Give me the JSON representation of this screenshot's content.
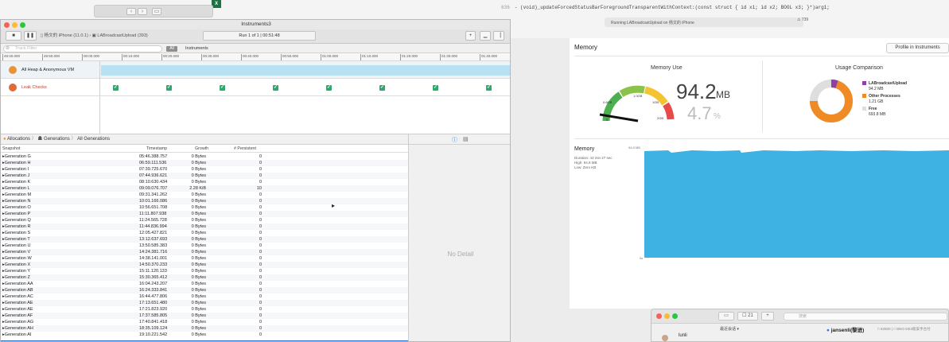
{
  "background": {
    "code_line_number": "636",
    "code_text": "- (void)_updateForcedStatusBarForegroundTransparentWithContext:(const struct { id x1; id x2; BOOL x3; }*)arg1;",
    "status_text": "Running LABroadcastUpload on 杨文的 iPhone",
    "status_count": "739",
    "excel_badge": "X"
  },
  "memory_panel": {
    "title": "Memory",
    "profile_button": "Profile in Instruments",
    "memory_use_title": "Memory Use",
    "value": "94.2",
    "unit": "MB",
    "percent": "4.7",
    "percent_sign": "%",
    "gauge_labels": [
      "0.6GB",
      "1.0GB",
      "1GB",
      "2GB",
      "0"
    ],
    "usage_title": "Usage Comparison",
    "legend": [
      {
        "name": "LABroadcastUpload",
        "value": "94.2 MB",
        "color": "#8e3fa8"
      },
      {
        "name": "Other Processes",
        "value": "1.21 GB",
        "color": "#f08a24"
      },
      {
        "name": "Free",
        "value": "693.8 MB",
        "color": "#dedede"
      }
    ],
    "graph_title": "Memory",
    "graph_info": [
      "Duration: 43 min 27 sec",
      "High: 94.8 MB",
      "Low: Zero KB"
    ],
    "graph_y_label": "94.8 MB",
    "graph_x_label": "0s",
    "graph_color": "#3db2e3"
  },
  "instruments": {
    "window_title": "Instruments3",
    "device": "杨文的 iPhone (11.0.1)",
    "target": "LABroadcastUpload (393)",
    "run_info": "Run 1 of 1  |  00:51:48",
    "filter_placeholder": "Track Filter",
    "filter_all": "All",
    "filter_instruments": "Instruments",
    "ruler_ticks": [
      "49:40.000",
      "49:50.000",
      "00:00.000",
      "00:10.000",
      "00:20.000",
      "00:30.000",
      "00:40.000",
      "00:50.000",
      "01:00.000",
      "01:10.000",
      "01:20.000",
      "01:30.000",
      "01:40.000"
    ],
    "tracks": [
      {
        "label": "All Heap & Anonymous VM",
        "color": "#e8943a"
      },
      {
        "label": "Leak Checks",
        "color": "#e06a3a"
      }
    ],
    "check_count": 8,
    "nav": {
      "allocations": "Allocations",
      "generations": "Generations",
      "all_generations": "All Generations"
    },
    "columns": {
      "snapshot": "Snapshot",
      "timestamp": "Timestamp",
      "growth": "Growth",
      "persistent": "# Persistent"
    },
    "rows": [
      {
        "name": "Generation G",
        "time": "05:46.388.757",
        "growth": "0 Bytes",
        "persistent": "0"
      },
      {
        "name": "Generation H",
        "time": "06:59.111.536",
        "growth": "0 Bytes",
        "persistent": "0"
      },
      {
        "name": "Generation I",
        "time": "07:39.725.670",
        "growth": "0 Bytes",
        "persistent": "0"
      },
      {
        "name": "Generation J",
        "time": "07:44.936.621",
        "growth": "0 Bytes",
        "persistent": "0"
      },
      {
        "name": "Generation K",
        "time": "08:10.630.434",
        "growth": "0 Bytes",
        "persistent": "0"
      },
      {
        "name": "Generation L",
        "time": "09:09.076.707",
        "growth": "2.28 KiB",
        "persistent": "10"
      },
      {
        "name": "Generation M",
        "time": "09:31.341.262",
        "growth": "0 Bytes",
        "persistent": "0"
      },
      {
        "name": "Generation N",
        "time": "10:01.166.086",
        "growth": "0 Bytes",
        "persistent": "0"
      },
      {
        "name": "Generation O",
        "time": "10:56.651.708",
        "growth": "0 Bytes",
        "persistent": "0"
      },
      {
        "name": "Generation P",
        "time": "11:11.807.938",
        "growth": "0 Bytes",
        "persistent": "0"
      },
      {
        "name": "Generation Q",
        "time": "11:24.565.728",
        "growth": "0 Bytes",
        "persistent": "0"
      },
      {
        "name": "Generation R",
        "time": "11:44.836.994",
        "growth": "0 Bytes",
        "persistent": "0"
      },
      {
        "name": "Generation S",
        "time": "12:05.427.821",
        "growth": "0 Bytes",
        "persistent": "0"
      },
      {
        "name": "Generation T",
        "time": "13:12.637.693",
        "growth": "0 Bytes",
        "persistent": "0"
      },
      {
        "name": "Generation U",
        "time": "13:50.585.383",
        "growth": "0 Bytes",
        "persistent": "0"
      },
      {
        "name": "Generation V",
        "time": "14:24.381.716",
        "growth": "0 Bytes",
        "persistent": "0"
      },
      {
        "name": "Generation W",
        "time": "14:38.141.001",
        "growth": "0 Bytes",
        "persistent": "0"
      },
      {
        "name": "Generation X",
        "time": "14:50.370.233",
        "growth": "0 Bytes",
        "persistent": "0"
      },
      {
        "name": "Generation Y",
        "time": "15:11.120.133",
        "growth": "0 Bytes",
        "persistent": "0"
      },
      {
        "name": "Generation Z",
        "time": "15:30.365.412",
        "growth": "0 Bytes",
        "persistent": "0"
      },
      {
        "name": "Generation AA",
        "time": "16:04.243.207",
        "growth": "0 Bytes",
        "persistent": "0"
      },
      {
        "name": "Generation AB",
        "time": "16:24.333.841",
        "growth": "0 Bytes",
        "persistent": "0"
      },
      {
        "name": "Generation AC",
        "time": "16:44.477.806",
        "growth": "0 Bytes",
        "persistent": "0"
      },
      {
        "name": "Generation AE",
        "time": "17:13.651.480",
        "growth": "0 Bytes",
        "persistent": "0"
      },
      {
        "name": "Generation AE",
        "time": "17:21.823.920",
        "growth": "0 Bytes",
        "persistent": "0"
      },
      {
        "name": "Generation AF",
        "time": "17:37.585.805",
        "growth": "0 Bytes",
        "persistent": "0"
      },
      {
        "name": "Generation AG",
        "time": "17:40.841.418",
        "growth": "0 Bytes",
        "persistent": "0"
      },
      {
        "name": "Generation AH",
        "time": "18:35.109.124",
        "growth": "0 Bytes",
        "persistent": "0"
      },
      {
        "name": "Generation AI",
        "time": "19:10.221.542",
        "growth": "0 Bytes",
        "persistent": "0"
      }
    ],
    "no_detail": "No Detail"
  },
  "chat": {
    "badge_count": "21",
    "search_placeholder": "搜索",
    "contact_name": "lunli",
    "recent_label": "最近会话",
    "user_name": "jansenli(黎进)",
    "user_meta": "□ 62500 | □ BNG-DE3能安手台付"
  }
}
